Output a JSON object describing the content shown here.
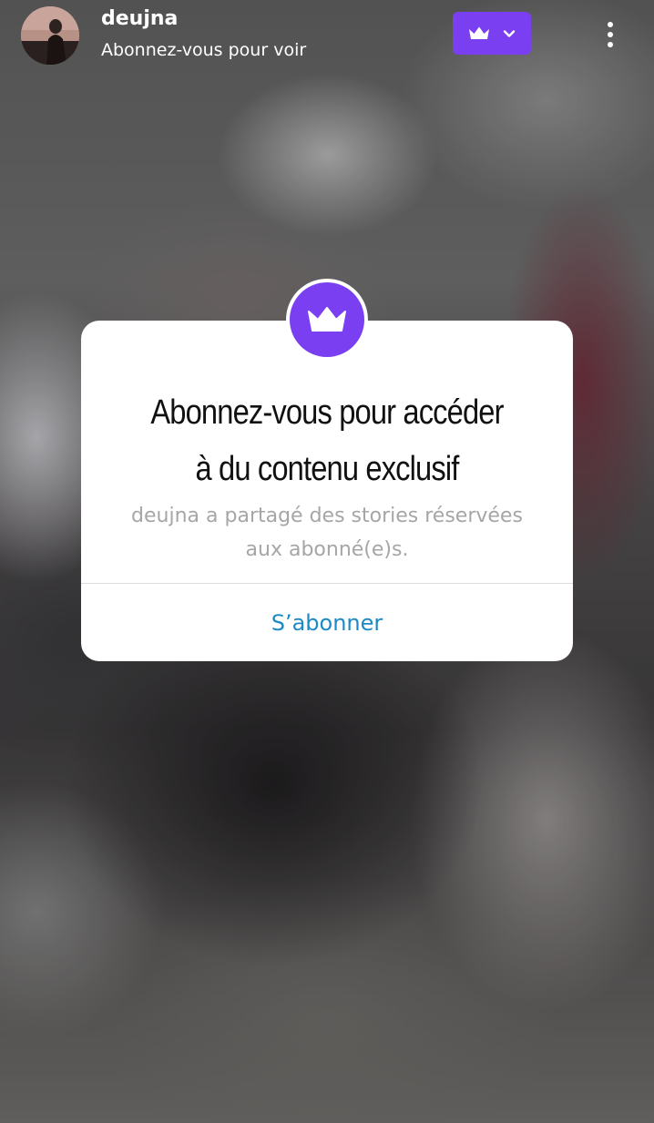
{
  "header": {
    "username": "deujna",
    "subtitle": "Abonnez-vous pour voir",
    "avatar_icon": "profile-photo",
    "subscription_menu_icons": [
      "crown-icon",
      "chevron-down-icon"
    ],
    "more_icon": "vertical-dots-icon"
  },
  "modal": {
    "badge_icon": "crown-icon",
    "title_line1": "Abonnez-vous pour accéder",
    "title_line2": "à du contenu exclusif",
    "description_line1": "deujna a partagé des stories réservées",
    "description_line2": "aux abonné(e)s.",
    "subscribe_label": "S’abonner"
  },
  "colors": {
    "accent_purple": "#7b3ff2",
    "link_blue": "#1b8ac6",
    "description_gray": "#a6a6a6"
  }
}
